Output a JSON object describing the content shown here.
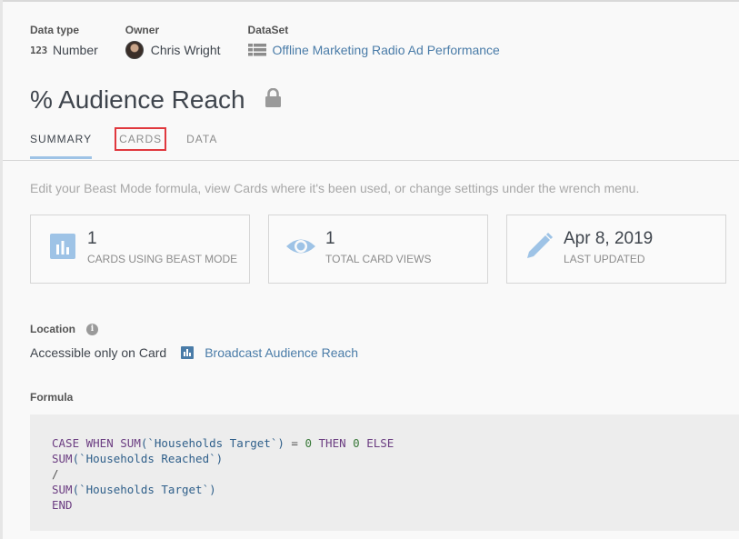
{
  "meta": {
    "data_type": {
      "label": "Data type",
      "icon_text": "123",
      "value": "Number"
    },
    "owner": {
      "label": "Owner",
      "value": "Chris Wright"
    },
    "dataset": {
      "label": "DataSet",
      "value": "Offline Marketing Radio Ad Performance"
    }
  },
  "title": "% Audience Reach",
  "tabs": [
    {
      "label": "SUMMARY"
    },
    {
      "label": "CARDS"
    },
    {
      "label": "DATA"
    }
  ],
  "description": "Edit your Beast Mode formula, view Cards where it's been used, or change settings under the wrench menu.",
  "stats": [
    {
      "icon": "bar-chart-icon",
      "value": "1",
      "label": "CARDS USING BEAST MODE"
    },
    {
      "icon": "eye-icon",
      "value": "1",
      "label": "TOTAL CARD VIEWS"
    },
    {
      "icon": "pencil-icon",
      "value": "Apr 8, 2019",
      "label": "LAST UPDATED"
    }
  ],
  "location": {
    "label": "Location",
    "info_glyph": "i",
    "value": "Accessible only on Card",
    "card_link": "Broadcast Audience Reach"
  },
  "formula": {
    "label": "Formula",
    "tokens": {
      "case_when": "CASE WHEN ",
      "sum": "SUM",
      "households_target": "(`Households Target`)",
      "equals": " = ",
      "zero": "0",
      "then": " THEN ",
      "else": " ELSE",
      "households_reached": "(`Households Reached`)",
      "divide": "/",
      "end": "END"
    }
  },
  "colors": {
    "accent": "#9ec3e6",
    "link": "#4a7ca8",
    "highlight_border": "#e0383e",
    "stat_icon": "#9ec3e6"
  }
}
